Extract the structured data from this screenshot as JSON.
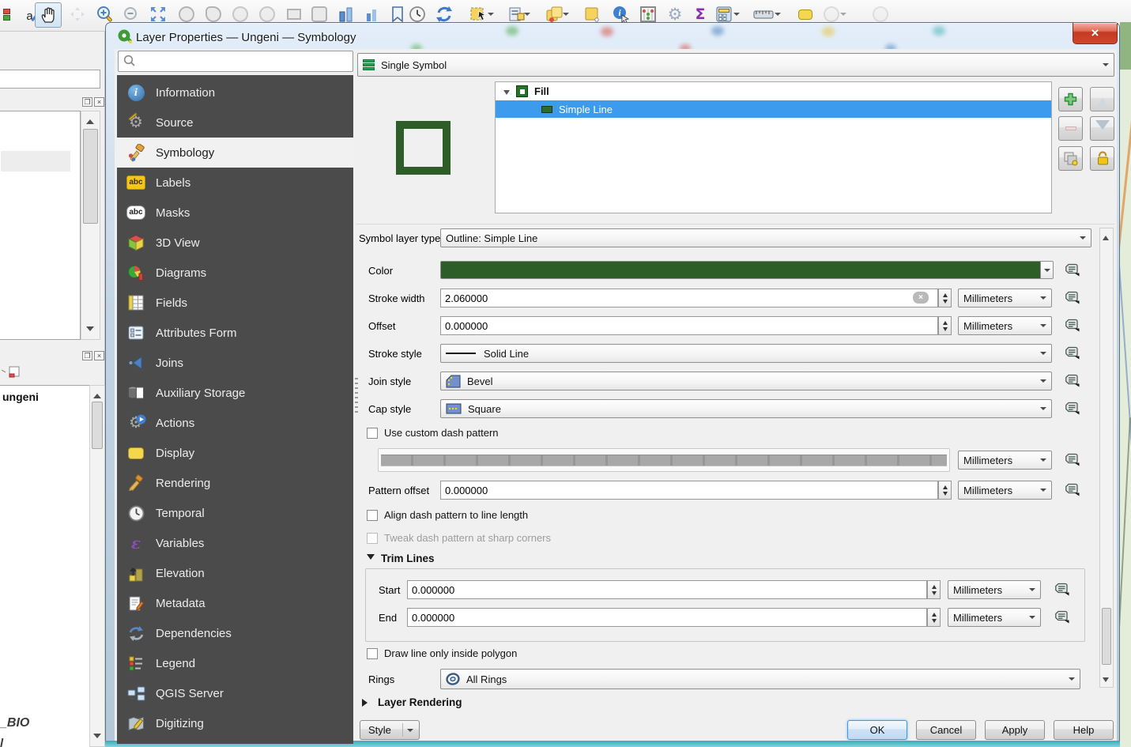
{
  "window": {
    "title": "Layer Properties — Ungeni — Symbology",
    "close": "×"
  },
  "toolbar": {
    "partial_label": "a",
    "icons": [
      "pan-map",
      "pan-to-selection",
      "zoom-in",
      "zoom-out",
      "zoom-full",
      "zoom-to-selection",
      "zoom-to-layer",
      "zoom-last",
      "zoom-next",
      "new-map-view",
      "bookmarks",
      "temporal-controller",
      "refresh",
      "select-features",
      "select-by-form",
      "deselect-all",
      "select-all",
      "identify-features",
      "statistical-summary",
      "processing-toolbox",
      "sum-features",
      "field-calculator",
      "measure",
      "map-tips",
      "annotations"
    ]
  },
  "left_panels": {
    "layers_item": "ungeni",
    "clipped_texts": [
      "_BIO",
      "l"
    ]
  },
  "sidebar": {
    "search": {
      "placeholder": ""
    },
    "items": [
      {
        "label": "Information"
      },
      {
        "label": "Source"
      },
      {
        "label": "Symbology"
      },
      {
        "label": "Labels"
      },
      {
        "label": "Masks"
      },
      {
        "label": "3D View"
      },
      {
        "label": "Diagrams"
      },
      {
        "label": "Fields"
      },
      {
        "label": "Attributes Form"
      },
      {
        "label": "Joins"
      },
      {
        "label": "Auxiliary Storage"
      },
      {
        "label": "Actions"
      },
      {
        "label": "Display"
      },
      {
        "label": "Rendering"
      },
      {
        "label": "Temporal"
      },
      {
        "label": "Variables"
      },
      {
        "label": "Elevation"
      },
      {
        "label": "Metadata"
      },
      {
        "label": "Dependencies"
      },
      {
        "label": "Legend"
      },
      {
        "label": "QGIS Server"
      },
      {
        "label": "Digitizing"
      }
    ]
  },
  "renderer": {
    "value": "Single Symbol"
  },
  "symbol_tree": {
    "root": {
      "label": "Fill"
    },
    "child": {
      "label": "Simple Line"
    }
  },
  "props": {
    "symbol_layer_type": {
      "label": "Symbol layer type",
      "value": "Outline: Simple Line"
    },
    "color": {
      "label": "Color",
      "value": "#2d5e28"
    },
    "stroke_width": {
      "label": "Stroke width",
      "value": "2.060000",
      "unit": "Millimeters"
    },
    "offset": {
      "label": "Offset",
      "value": "0.000000",
      "unit": "Millimeters"
    },
    "stroke_style": {
      "label": "Stroke style",
      "value": "Solid Line"
    },
    "join_style": {
      "label": "Join style",
      "value": "Bevel"
    },
    "cap_style": {
      "label": "Cap style",
      "value": "Square"
    },
    "use_custom_dash": {
      "label": "Use custom dash pattern",
      "checked": false
    },
    "dash_pattern_unit": "Millimeters",
    "pattern_offset": {
      "label": "Pattern offset",
      "value": "0.000000",
      "unit": "Millimeters"
    },
    "align_dash": {
      "label": "Align dash pattern to line length",
      "checked": false
    },
    "tweak_dash": {
      "label": "Tweak dash pattern at sharp corners",
      "checked": false
    },
    "trim_lines": {
      "title": "Trim Lines",
      "start": {
        "label": "Start",
        "value": "0.000000",
        "unit": "Millimeters"
      },
      "end": {
        "label": "End",
        "value": "0.000000",
        "unit": "Millimeters"
      }
    },
    "draw_inside": {
      "label": "Draw line only inside polygon",
      "checked": false
    },
    "rings": {
      "label": "Rings",
      "value": "All Rings"
    },
    "layer_rendering": {
      "title": "Layer Rendering"
    }
  },
  "footer": {
    "style": "Style",
    "ok": "OK",
    "cancel": "Cancel",
    "apply": "Apply",
    "help": "Help"
  }
}
